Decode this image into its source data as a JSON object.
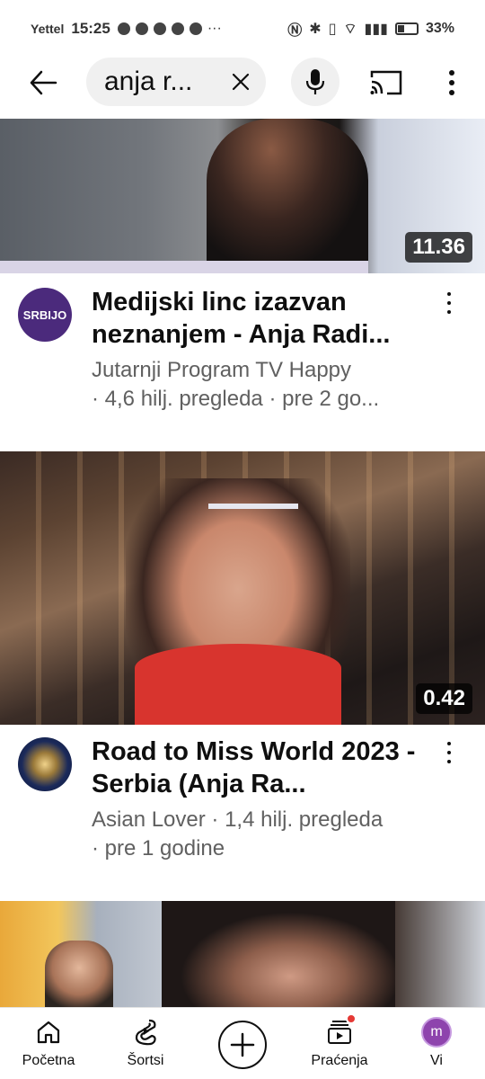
{
  "status_bar": {
    "carrier": "Yettel",
    "time": "15:25",
    "battery": "33%"
  },
  "search": {
    "query": "anja r..."
  },
  "videos": [
    {
      "duration": "11.36",
      "title": "Medijski linc izazvan neznanjem - Anja Radi...",
      "channel_line": "Jutarnji Program TV Happy",
      "stats_line": "· 4,6 hilj. pregleda · pre 2 go...",
      "avatar_text": "SRBIJO"
    },
    {
      "duration": "0.42",
      "title": "Road to Miss World 2023 - Serbia (Anja Ra...",
      "channel_line": "Asian Lover · 1,4 hilj. pregleda",
      "stats_line": "· pre 1 godine"
    }
  ],
  "bottom_nav": {
    "home": "Početna",
    "shorts": "Šortsi",
    "subscriptions": "Praćenja",
    "you": "Vi",
    "you_avatar_letter": "m"
  },
  "icons": [
    "back-arrow-icon",
    "clear-icon",
    "mic-icon",
    "cast-icon",
    "more-vert-icon",
    "home-icon",
    "shorts-icon",
    "create-icon",
    "subscriptions-icon"
  ]
}
